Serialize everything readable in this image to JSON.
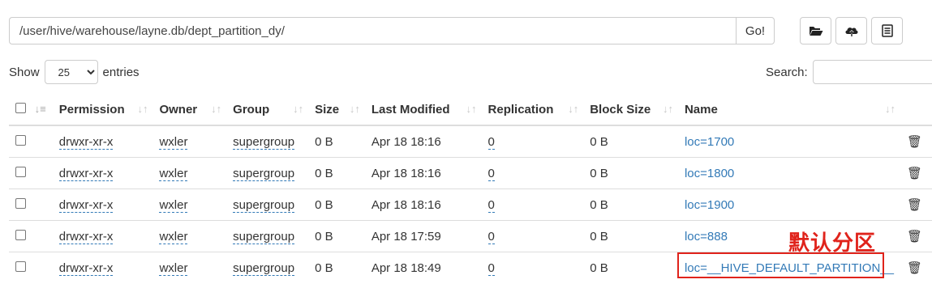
{
  "path": {
    "value": "/user/hive/warehouse/layne.db/dept_partition_dy/",
    "go_label": "Go!"
  },
  "toolbar": {
    "icons": [
      "folder-open-icon",
      "upload-cloud-icon",
      "list-icon"
    ]
  },
  "length": {
    "show_label": "Show",
    "selected": "25",
    "entries_label": "entries"
  },
  "search": {
    "label": "Search:",
    "value": ""
  },
  "table": {
    "columns": [
      "Permission",
      "Owner",
      "Group",
      "Size",
      "Last Modified",
      "Replication",
      "Block Size",
      "Name"
    ],
    "rows": [
      {
        "permission": "drwxr-xr-x",
        "owner": "wxler",
        "group": "supergroup",
        "size": "0 B",
        "modified": "Apr 18 18:16",
        "replication": "0",
        "block_size": "0 B",
        "name": "loc=1700"
      },
      {
        "permission": "drwxr-xr-x",
        "owner": "wxler",
        "group": "supergroup",
        "size": "0 B",
        "modified": "Apr 18 18:16",
        "replication": "0",
        "block_size": "0 B",
        "name": "loc=1800"
      },
      {
        "permission": "drwxr-xr-x",
        "owner": "wxler",
        "group": "supergroup",
        "size": "0 B",
        "modified": "Apr 18 18:16",
        "replication": "0",
        "block_size": "0 B",
        "name": "loc=1900"
      },
      {
        "permission": "drwxr-xr-x",
        "owner": "wxler",
        "group": "supergroup",
        "size": "0 B",
        "modified": "Apr 18 17:59",
        "replication": "0",
        "block_size": "0 B",
        "name": "loc=888"
      },
      {
        "permission": "drwxr-xr-x",
        "owner": "wxler",
        "group": "supergroup",
        "size": "0 B",
        "modified": "Apr 18 18:49",
        "replication": "0",
        "block_size": "0 B",
        "name": "loc=__HIVE_DEFAULT_PARTITION__"
      }
    ]
  },
  "annotation": {
    "text": "默认分区",
    "color": "#e0231b"
  },
  "colors": {
    "link": "#337ab7",
    "border": "#dddddd"
  }
}
